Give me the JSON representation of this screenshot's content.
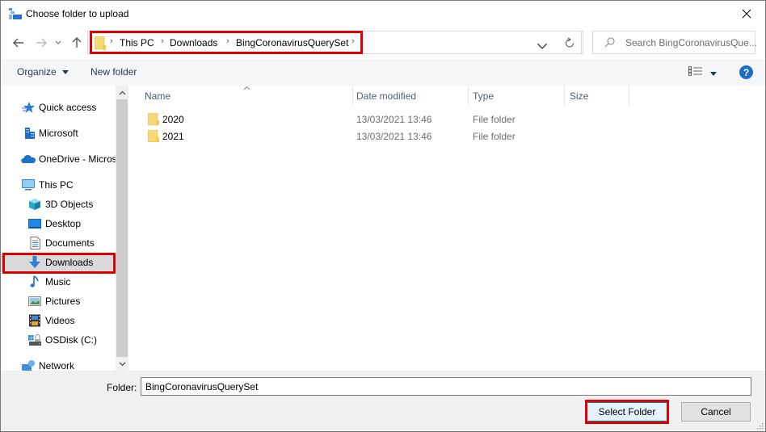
{
  "window": {
    "title": "Choose folder to upload"
  },
  "navigation": {
    "breadcrumbs": [
      "This PC",
      "Downloads",
      "BingCoronavirusQuerySet"
    ],
    "search_placeholder": "Search BingCoronavirusQue..."
  },
  "toolbar": {
    "organize_label": "Organize",
    "new_folder_label": "New folder"
  },
  "sidebar": {
    "items": [
      {
        "label": "Quick access",
        "icon": "star-icon"
      },
      {
        "label": "Microsoft",
        "icon": "building-icon"
      },
      {
        "label": "OneDrive - Micros",
        "icon": "cloud-icon"
      },
      {
        "label": "This PC",
        "icon": "computer-icon"
      },
      {
        "label": "3D Objects",
        "icon": "cube-icon"
      },
      {
        "label": "Desktop",
        "icon": "desktop-icon"
      },
      {
        "label": "Documents",
        "icon": "document-icon"
      },
      {
        "label": "Downloads",
        "icon": "download-arrow-icon",
        "selected": true
      },
      {
        "label": "Music",
        "icon": "music-note-icon"
      },
      {
        "label": "Pictures",
        "icon": "picture-icon"
      },
      {
        "label": "Videos",
        "icon": "film-icon"
      },
      {
        "label": "OSDisk (C:)",
        "icon": "disk-drive-icon"
      },
      {
        "label": "Network",
        "icon": "network-icon"
      }
    ]
  },
  "filelist": {
    "columns": [
      "Name",
      "Date modified",
      "Type",
      "Size"
    ],
    "rows": [
      {
        "name": "2020",
        "date": "13/03/2021 13:46",
        "type": "File folder",
        "size": ""
      },
      {
        "name": "2021",
        "date": "13/03/2021 13:46",
        "type": "File folder",
        "size": ""
      }
    ]
  },
  "footer": {
    "folder_label": "Folder:",
    "folder_value": "BingCoronavirusQuerySet",
    "select_label": "Select Folder",
    "cancel_label": "Cancel"
  },
  "colors": {
    "highlight": "#e00000",
    "accent": "#0078d7",
    "folder": "#f8d775"
  }
}
